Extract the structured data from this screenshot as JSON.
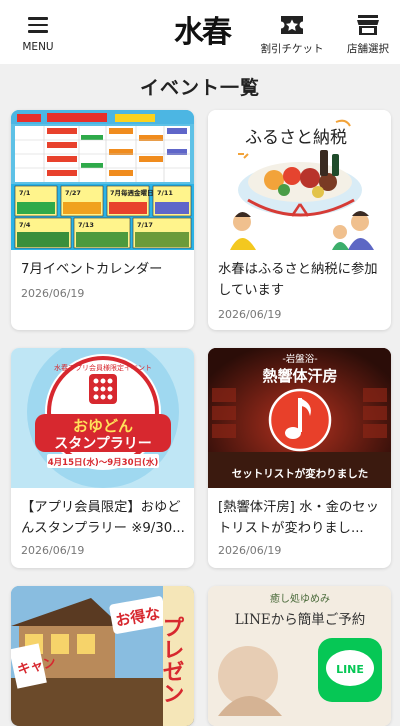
{
  "header": {
    "menu_label": "MENU",
    "logo_text": "水春",
    "ticket_label": "割引チケット",
    "store_label": "店舗選択"
  },
  "page_title": "イベント一覧",
  "events": [
    {
      "title": "7月イベントカレンダー",
      "date": "2026/06/19"
    },
    {
      "title": "水春はふるさと納税に参加しています",
      "date": "2026/06/19"
    },
    {
      "title": "【アプリ会員限定】おゆどんスタンプラリー ※9/30...",
      "date": "2026/06/19"
    },
    {
      "title": "[熱響体汗房] 水・金のセットリストが変わりまし...",
      "date": "2026/06/19"
    }
  ],
  "thumbs": {
    "calendar": {
      "row1": [
        "7/1",
        "7/27",
        "7月毎週金曜日",
        "7/11"
      ],
      "row2": [
        "7/4",
        "7/13",
        "7/17"
      ]
    },
    "furusato": {
      "caption": "ふるさと納税"
    },
    "stamp": {
      "arc_text": "水春アプリ会員様限定イベント",
      "title1": "おゆどん",
      "title2": "スタンプラリー",
      "period": "4月15日(水)〜9月30日(水)"
    },
    "sauna": {
      "sub": "-岩盤浴-",
      "title": "熱響体汗房",
      "caption": "セットリストが変わりました"
    },
    "present": {
      "tag": "お得な",
      "text": "プレゼン",
      "side": "キャン"
    },
    "line": {
      "brand": "癒し処ゆめみ",
      "text": "LINEから簡単ご予約",
      "logo": "LINE"
    }
  },
  "colors": {
    "background": "#f0f0f0",
    "card": "#ffffff",
    "line_green": "#06c755",
    "stamp_red": "#d7282f",
    "sauna_red": "#c0271c"
  }
}
